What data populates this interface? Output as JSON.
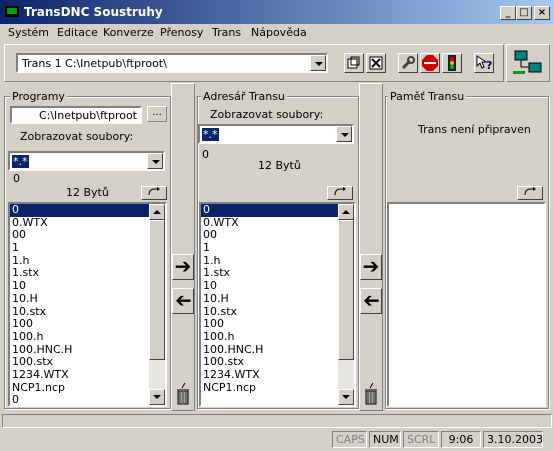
{
  "window": {
    "title": "TransDNC Soustruhy",
    "buttons": {
      "minimize": "_",
      "maximize": "□",
      "close": "×"
    }
  },
  "menu": [
    "Systém",
    "Editace",
    "Konverze",
    "Přenosy",
    "Trans",
    "Nápověda"
  ],
  "toolbar": {
    "trans_combo": "Trans 1   C:\\Inetpub\\ftproot\\",
    "icons": [
      "copy-icon",
      "close-x-icon",
      "wrench-icon",
      "stop-icon",
      "traffic-light-icon",
      "help-icon",
      "network-icon"
    ]
  },
  "programy": {
    "label": "Programy",
    "path": "C:\\Inetpub\\ftproot",
    "browse_label": "...",
    "filter_label": "Zobrazovat soubory:",
    "filter_value": "*.*",
    "count": "0",
    "bytes": "12 Bytů",
    "files": [
      "0",
      "0.WTX",
      "00",
      "1",
      "1.h",
      "1.stx",
      "10",
      "10.H",
      "10.stx",
      "100",
      "100.h",
      "100.HNC.H",
      "100.stx",
      "1234.WTX",
      "NCP1.ncp",
      "0"
    ]
  },
  "adresar": {
    "label": "Adresář Transu",
    "filter_label": "Zobrazovat soubory:",
    "filter_value": "*.*",
    "count": "0",
    "bytes": "12 Bytů",
    "files": [
      "0",
      "0.WTX",
      "00",
      "1",
      "1.h",
      "1.stx",
      "10",
      "10.H",
      "10.stx",
      "100",
      "100.h",
      "100.HNC.H",
      "100.stx",
      "1234.WTX",
      "NCP1.ncp"
    ]
  },
  "pamet": {
    "label": "Paměť Transu",
    "status": "Trans není připraven"
  },
  "statusbar": {
    "caps": "CAPS",
    "num": "NUM",
    "scrl": "SCRL",
    "time": "9:06",
    "date": "3.10.2003"
  },
  "colors": {
    "titlebar": "#0a246a",
    "selection": "#0a246a",
    "face": "#d4d0c8"
  }
}
